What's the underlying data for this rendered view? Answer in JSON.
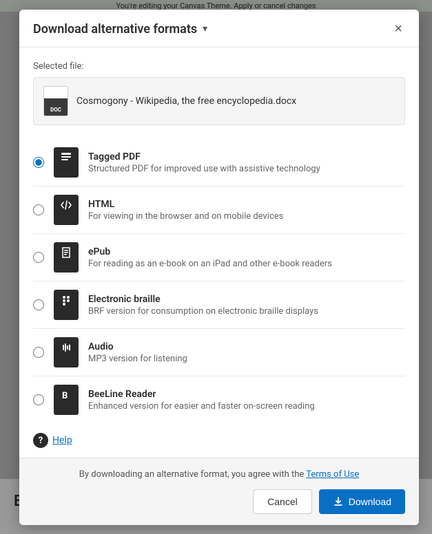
{
  "modal": {
    "title": "Download alternative formats",
    "close_label": "×",
    "selected_file_label": "Selected file:",
    "selected_file_name": "Cosmogony - Wikipedia, the free encyclopedia.docx",
    "formats": [
      {
        "id": "tagged-pdf",
        "name": "Tagged PDF",
        "description": "Structured PDF for improved use with assistive technology",
        "icon_type": "pdf",
        "checked": true
      },
      {
        "id": "html",
        "name": "HTML",
        "description": "For viewing in the browser and on mobile devices",
        "icon_type": "html",
        "checked": false
      },
      {
        "id": "epub",
        "name": "ePub",
        "description": "For reading as an e-book on an iPad and other e-book readers",
        "icon_type": "epub",
        "checked": false
      },
      {
        "id": "braille",
        "name": "Electronic braille",
        "description": "BRF version for consumption on electronic braille displays",
        "icon_type": "braille",
        "checked": false
      },
      {
        "id": "audio",
        "name": "Audio",
        "description": "MP3 version for listening",
        "icon_type": "audio",
        "checked": false
      },
      {
        "id": "beeline",
        "name": "BeeLine Reader",
        "description": "Enhanced version for easier and faster on-screen reading",
        "icon_type": "beeline",
        "checked": false
      }
    ],
    "help_label": "Help",
    "footer": {
      "terms_text_before": "By downloading an alternative format, you agree with the",
      "terms_link_label": "Terms of Use",
      "cancel_label": "Cancel",
      "download_label": "Download"
    }
  },
  "background": {
    "top_banner": "You're editing your Canvas Theme. Apply or cancel changes",
    "article_heading": "Etymology"
  }
}
